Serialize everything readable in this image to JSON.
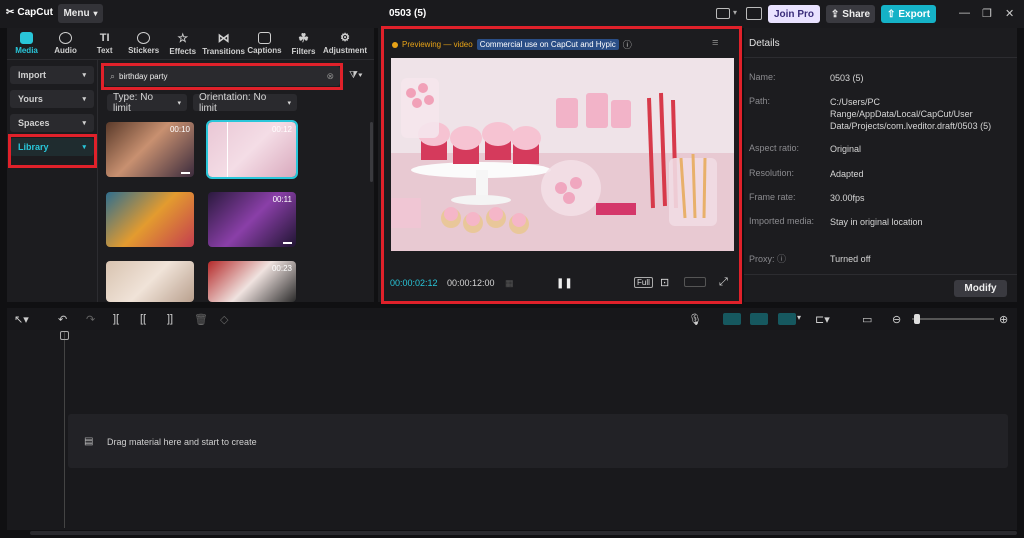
{
  "app": {
    "logo": "CapCut",
    "menu": "Menu",
    "project_title": "0503 (5)"
  },
  "header_buttons": {
    "join_pro": "Join Pro",
    "share": "Share",
    "export": "Export"
  },
  "tabs": [
    {
      "label": "Media",
      "icon": "media-icon"
    },
    {
      "label": "Audio",
      "icon": "audio-icon"
    },
    {
      "label": "Text",
      "icon": "text-icon"
    },
    {
      "label": "Stickers",
      "icon": "stickers-icon"
    },
    {
      "label": "Effects",
      "icon": "effects-icon"
    },
    {
      "label": "Transitions",
      "icon": "transitions-icon"
    },
    {
      "label": "Captions",
      "icon": "captions-icon"
    },
    {
      "label": "Filters",
      "icon": "filters-icon"
    },
    {
      "label": "Adjustment",
      "icon": "adjustment-icon"
    }
  ],
  "sidebar": {
    "items": [
      {
        "label": "Import"
      },
      {
        "label": "Yours"
      },
      {
        "label": "Spaces"
      },
      {
        "label": "Library"
      }
    ]
  },
  "search": {
    "value": "birthday party"
  },
  "filters": {
    "type": "Type: No limit",
    "orientation": "Orientation: No limit"
  },
  "thumbnails": [
    {
      "duration": "00:10"
    },
    {
      "duration": "00:12"
    },
    {
      "duration": ""
    },
    {
      "duration": "00:11"
    },
    {
      "duration": ""
    },
    {
      "duration": "00:23"
    }
  ],
  "preview": {
    "status": "Previewing — video",
    "commercial": "Commercial use on CapCut and Hypic",
    "current_time": "00:00:02:12",
    "total_time": "00:00:12:00",
    "full_label": "Full"
  },
  "details": {
    "title": "Details",
    "rows": [
      {
        "label": "Name:",
        "value": "0503 (5)"
      },
      {
        "label": "Path:",
        "value": "C:/Users/PC Range/AppData/Local/CapCut/User Data/Projects/com.lveditor.draft/0503 (5)"
      },
      {
        "label": "Aspect ratio:",
        "value": "Original"
      },
      {
        "label": "Resolution:",
        "value": "Adapted"
      },
      {
        "label": "Frame rate:",
        "value": "30.00fps"
      },
      {
        "label": "Imported media:",
        "value": "Stay in original location"
      },
      {
        "label": "Proxy:",
        "value": "Turned off"
      }
    ],
    "modify": "Modify"
  },
  "timeline": {
    "hint": "Drag material here and start to create"
  },
  "colors": {
    "accent": "#29c6d9",
    "highlight": "#e0212a",
    "export": "#15b2c7"
  }
}
